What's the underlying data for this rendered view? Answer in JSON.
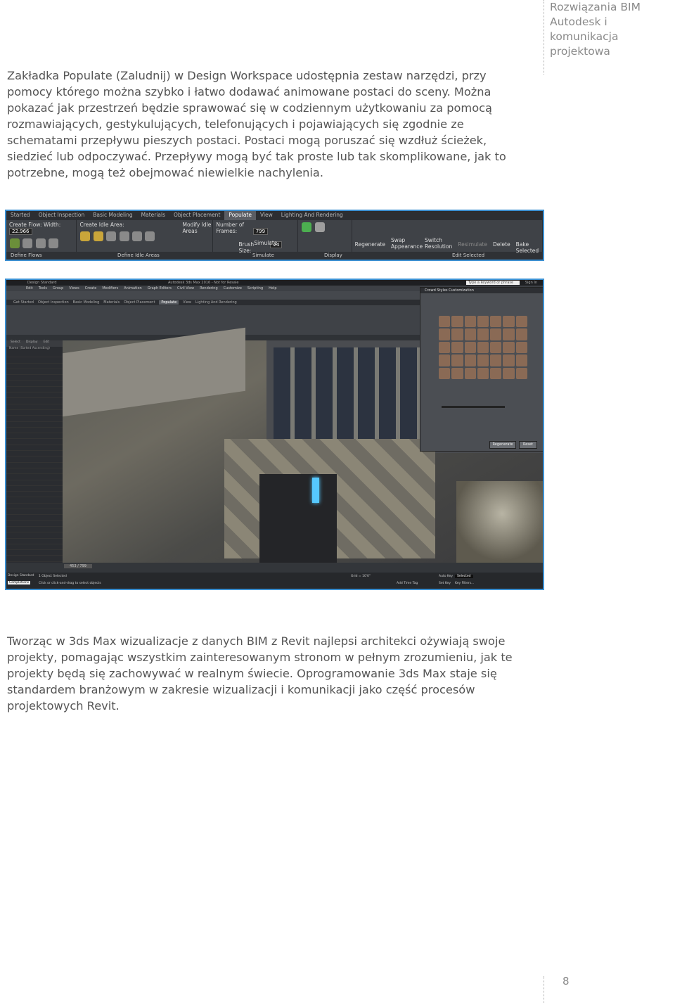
{
  "header": {
    "line1": "Rozwiązania BIM",
    "line2": "Autodesk i komunikacja",
    "line3": "projektowa"
  },
  "paragraph1": "Zakładka Populate (Zaludnij) w Design Workspace udostępnia zestaw narzędzi, przy pomocy którego można szybko i łatwo dodawać animowane postaci do sceny. Można pokazać jak przestrzeń będzie sprawować się w codziennym użytkowaniu za pomocą rozmawiających, gestykulujących, telefonujących i pojawiających się zgodnie ze schematami przepływu pieszych postaci. Postaci mogą poruszać się wzdłuż ścieżek, siedzieć lub odpoczywać. Przepływy mogą być tak proste lub tak skomplikowane, jak to potrzebne, mogą też obejmować niewielkie nachylenia.",
  "ribbon": {
    "tabs": [
      "Started",
      "Object Inspection",
      "Basic Modeling",
      "Materials",
      "Object Placement",
      "Populate",
      "View",
      "Lighting And Rendering"
    ],
    "active_tab": "Populate",
    "create_flow": "Create Flow:",
    "width_label": "Width:",
    "width_value": "22.966",
    "create_idle": "Create Idle Area:",
    "modify_idle": "Modify Idle Areas",
    "brush_label": "Brush Size:",
    "brush_value": "24",
    "frames_label": "Number of Frames:",
    "frames_value": "799",
    "simulate": "Simulate",
    "regenerate": "Regenerate",
    "swap": "Swap Appearance",
    "switch_res": "Switch Resolution",
    "resimulate": "Resimulate",
    "delete": "Delete",
    "bake": "Bake Selected",
    "footer": [
      "Define Flows",
      "Define Idle Areas",
      "Simulate",
      "Display",
      "Edit Selected"
    ]
  },
  "screenshot": {
    "title": "Autodesk 3ds Max 2016 - Not for Resale",
    "workspace": "Design Standard",
    "menu": [
      "Edit",
      "Tools",
      "Group",
      "Views",
      "Create",
      "Modifiers",
      "Animation",
      "Graph Editors",
      "Civil View",
      "Rendering",
      "Customize",
      "Scripting",
      "Help"
    ],
    "search_placeholder": "Type a keyword or phrase",
    "sign_in": "Sign In",
    "tabs": [
      "Get Started",
      "Object Inspection",
      "Basic Modeling",
      "Materials",
      "Object Placement",
      "Populate",
      "View",
      "Lighting And Rendering"
    ],
    "panel_tabs": [
      "Select",
      "Display",
      "Edit"
    ],
    "panel_header": "Name (Sorted Ascending)",
    "dialog_title": "Crowd Styles Customization",
    "dialog_regenerate": "Regenerate",
    "dialog_reset": "Reset",
    "frame_counter": "453 / 799",
    "status_selected": "1 Object Selected",
    "status_hint": "Click or click-and-drag to select objects",
    "add_time_tag": "Add Time Tag",
    "auto_key": "Auto Key",
    "set_key": "Set Key",
    "key_filters": "Key Filters...",
    "selected": "Selected",
    "grid": "Grid = 10'0\"",
    "console": "Completions",
    "ws_bottom": "Design Standard"
  },
  "paragraph2": "Tworząc w 3ds Max wizualizacje z danych BIM z Revit najlepsi architekci ożywiają swoje projekty, pomagając wszystkim zainteresowanym stronom w pełnym zrozumieniu, jak te projekty będą się zachowywać w realnym świecie. Oprogramowanie 3ds Max staje się standardem branżowym w zakresie wizualizacji i komunikacji jako część procesów projektowych Revit.",
  "page_number": "8"
}
